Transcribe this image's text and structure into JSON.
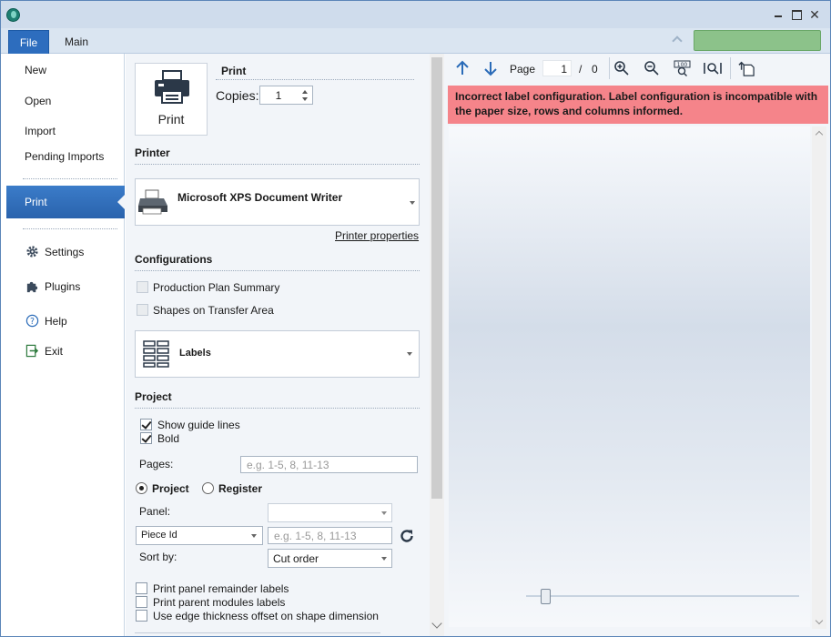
{
  "tabs": {
    "file": "File",
    "main": "Main"
  },
  "nav": {
    "new": "New",
    "open": "Open",
    "import": "Import",
    "pending_imports": "Pending Imports",
    "print": "Print",
    "settings": "Settings",
    "plugins": "Plugins",
    "help": "Help",
    "exit": "Exit"
  },
  "print_section": {
    "button_label": "Print",
    "heading": "Print",
    "copies_label": "Copies:",
    "copies_value": "1"
  },
  "printer": {
    "heading": "Printer",
    "selected": "Microsoft XPS Document Writer",
    "properties_link": "Printer properties"
  },
  "configurations": {
    "heading": "Configurations",
    "production_plan_summary": "Production Plan Summary",
    "shapes_on_transfer_area": "Shapes on Transfer Area",
    "type_selected": "Labels"
  },
  "project": {
    "heading": "Project",
    "show_guide_lines": "Show guide lines",
    "bold": "Bold",
    "pages_label": "Pages:",
    "pages_placeholder": "e.g. 1-5, 8, 11-13",
    "radio_project": "Project",
    "radio_register": "Register",
    "panel_label": "Panel:",
    "panel_value": "",
    "piece_field": "Piece Id",
    "piece_placeholder": "e.g. 1-5, 8, 11-13",
    "sort_by_label": "Sort by:",
    "sort_by_value": "Cut order",
    "print_panel_remainder": "Print panel remainder labels",
    "print_parent_modules": "Print parent modules labels",
    "edge_thickness_offset": "Use edge thickness offset on shape dimension"
  },
  "preview": {
    "page_label": "Page",
    "page_current": "1",
    "page_separator": "/",
    "page_total": "0",
    "error_message": "Incorrect label configuration. Label configuration is incompatible with the paper size, rows and columns informed.",
    "zoom_percent": 10
  }
}
